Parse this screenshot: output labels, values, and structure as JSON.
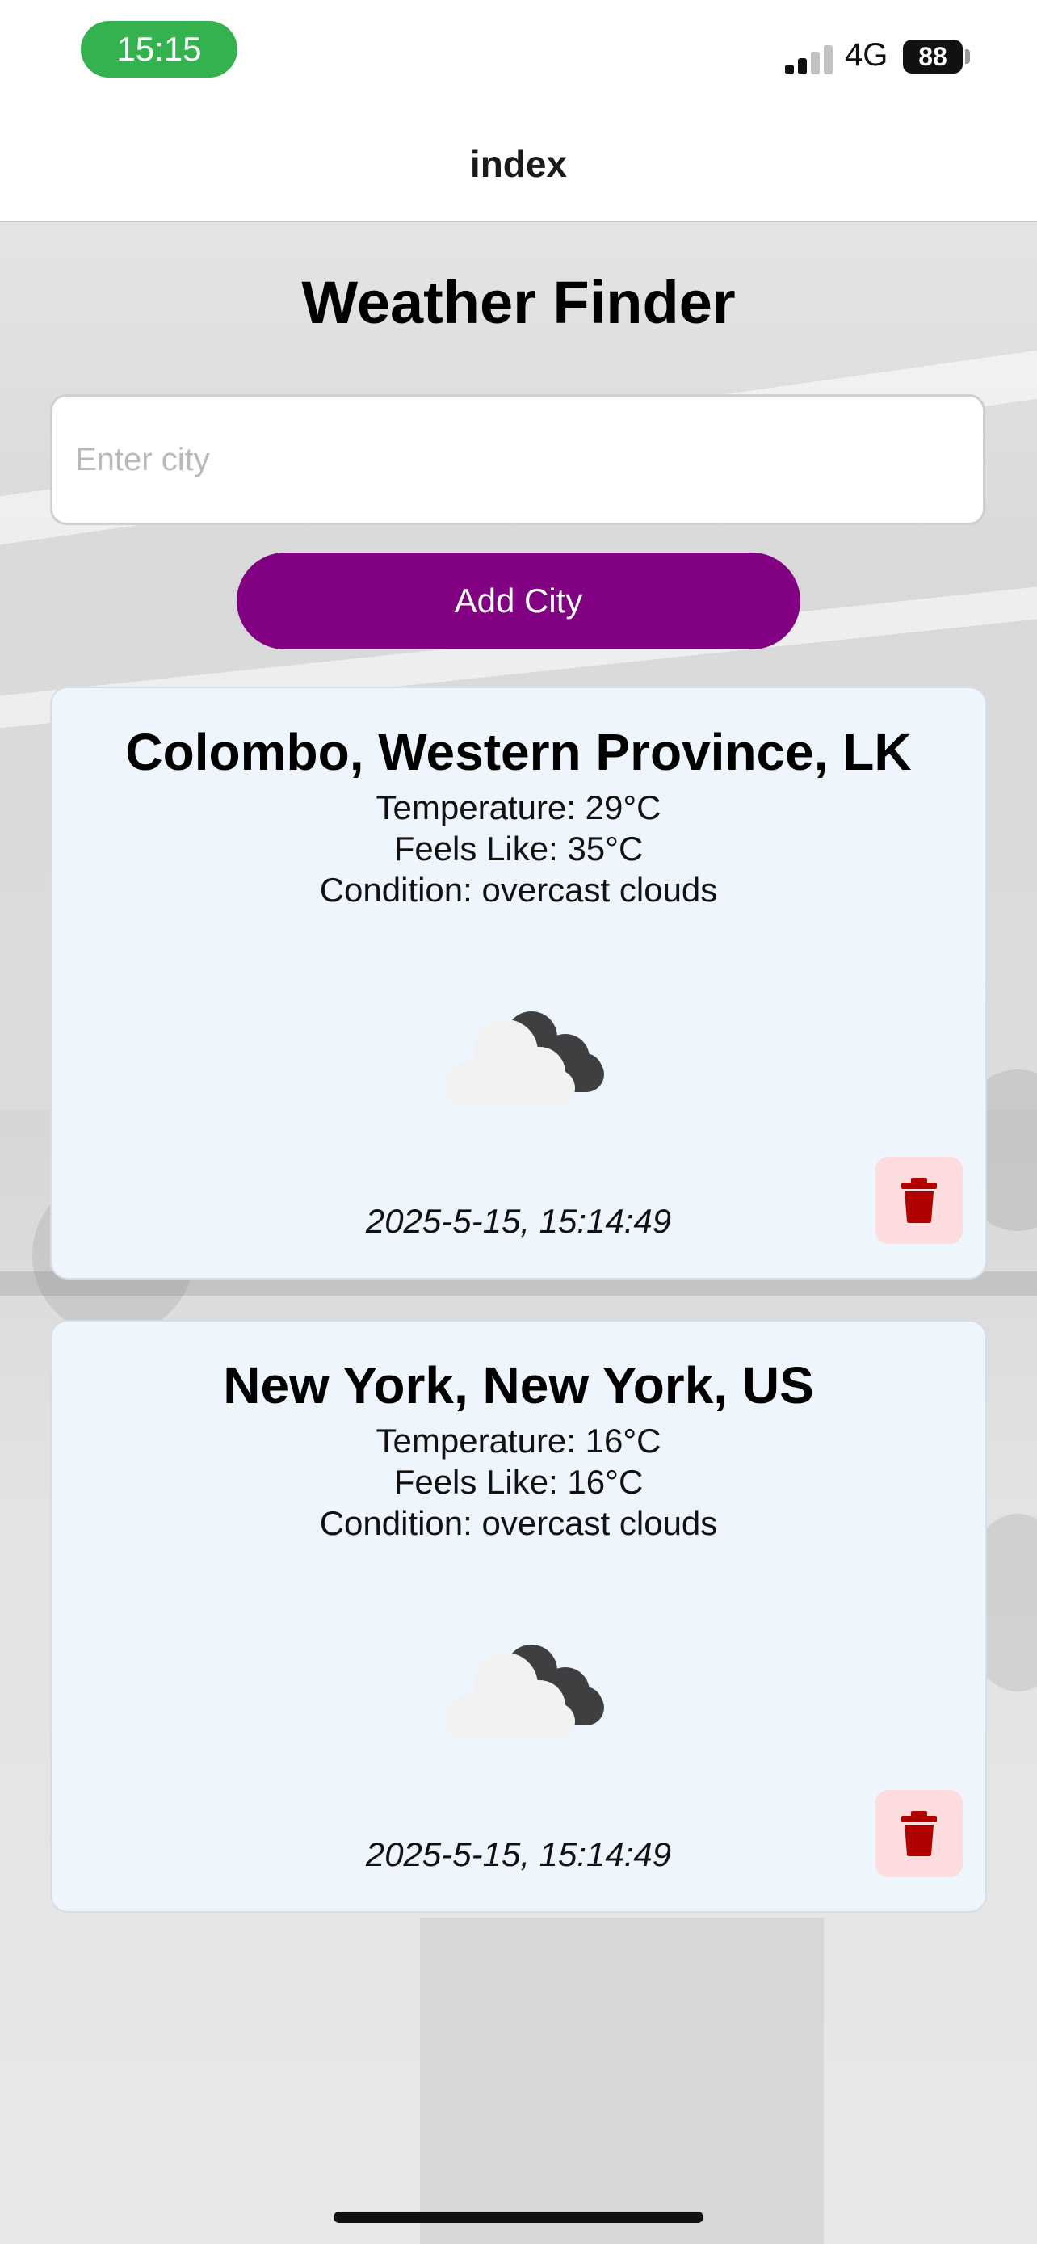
{
  "status_bar": {
    "time": "15:15",
    "network": "4G",
    "battery": "88"
  },
  "nav": {
    "title": "index"
  },
  "page": {
    "title": "Weather Finder",
    "city_input": {
      "value": "",
      "placeholder": "Enter city"
    },
    "add_button_label": "Add City"
  },
  "cards": [
    {
      "city": "Colombo, Western Province, LK",
      "temperature": "Temperature: 29°C",
      "feels_like": "Feels Like: 35°C",
      "condition": "Condition: overcast clouds",
      "timestamp": "2025-5-15, 15:14:49",
      "icon": "overcast-clouds-icon"
    },
    {
      "city": "New York, New York, US",
      "temperature": "Temperature: 16°C",
      "feels_like": "Feels Like: 16°C",
      "condition": "Condition: overcast clouds",
      "timestamp": "2025-5-15, 15:14:49",
      "icon": "overcast-clouds-icon"
    }
  ],
  "colors": {
    "accent": "#820082",
    "time_pill": "#34b24f",
    "card_bg": "#eef5fd",
    "delete_bg": "#fcdcdc",
    "delete_icon": "#b00000"
  }
}
